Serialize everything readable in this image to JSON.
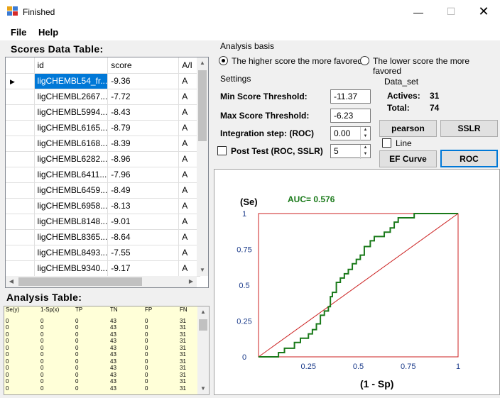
{
  "window": {
    "title": "Finished"
  },
  "menu": {
    "file": "File",
    "help": "Help"
  },
  "scores_table": {
    "title": "Scores Data Table:",
    "columns": [
      "id",
      "score",
      "A/I"
    ],
    "rows": [
      [
        "ligCHEMBL54_fr...",
        "-9.36",
        "A"
      ],
      [
        "ligCHEMBL2667...",
        "-7.72",
        "A"
      ],
      [
        "ligCHEMBL5994...",
        "-8.43",
        "A"
      ],
      [
        "ligCHEMBL6165...",
        "-8.79",
        "A"
      ],
      [
        "ligCHEMBL6168...",
        "-8.39",
        "A"
      ],
      [
        "ligCHEMBL6282...",
        "-8.96",
        "A"
      ],
      [
        "ligCHEMBL6411...",
        "-7.96",
        "A"
      ],
      [
        "ligCHEMBL6459...",
        "-8.49",
        "A"
      ],
      [
        "ligCHEMBL6958...",
        "-8.13",
        "A"
      ],
      [
        "ligCHEMBL8148...",
        "-9.01",
        "A"
      ],
      [
        "ligCHEMBL8365...",
        "-8.64",
        "A"
      ],
      [
        "ligCHEMBL8493...",
        "-7.55",
        "A"
      ],
      [
        "ligCHEMBL9340...",
        "-9.17",
        "A"
      ]
    ]
  },
  "analysis_table": {
    "title": "Analysis Table:",
    "columns": [
      "Se(y)",
      "1-Sp(x)",
      "TP",
      "TN",
      "FP",
      "FN"
    ],
    "rows": [
      [
        "0",
        "0",
        "0",
        "43",
        "0",
        "31"
      ],
      [
        "0",
        "0",
        "0",
        "43",
        "0",
        "31"
      ],
      [
        "0",
        "0",
        "0",
        "43",
        "0",
        "31"
      ],
      [
        "0",
        "0",
        "0",
        "43",
        "0",
        "31"
      ],
      [
        "0",
        "0",
        "0",
        "43",
        "0",
        "31"
      ],
      [
        "0",
        "0",
        "0",
        "43",
        "0",
        "31"
      ],
      [
        "0",
        "0",
        "0",
        "43",
        "0",
        "31"
      ],
      [
        "0",
        "0",
        "0",
        "43",
        "0",
        "31"
      ],
      [
        "0",
        "0",
        "0",
        "43",
        "0",
        "31"
      ],
      [
        "0",
        "0",
        "0",
        "43",
        "0",
        "31"
      ],
      [
        "0",
        "0",
        "0",
        "43",
        "0",
        "31"
      ]
    ]
  },
  "analysis_basis": {
    "label": "Analysis basis",
    "option_higher": "The higher score the more favored",
    "option_lower": "The lower  score the more favored",
    "selected": "higher"
  },
  "settings": {
    "label": "Settings",
    "min_label": "Min Score Threshold:",
    "min_value": "-11.37",
    "max_label": "Max Score Threshold:",
    "max_value": "-6.23",
    "step_label": "Integration step: (ROC)",
    "step_value": "0.00",
    "post_label": "Post Test (ROC, SSLR)",
    "post_value": "5",
    "post_checked": false
  },
  "dataset": {
    "label": "Data_set",
    "actives_label": "Actives:",
    "actives_value": "31",
    "total_label": "Total:",
    "total_value": "74"
  },
  "buttons": {
    "pearson": "pearson",
    "sslr": "SSLR",
    "line": "Line",
    "line_checked": false,
    "ef_curve": "EF Curve",
    "roc": "ROC"
  },
  "chart_data": {
    "type": "line",
    "annotation": "AUC= 0.576",
    "ylabel": "(Se)",
    "xlabel": "(1 - Sp)",
    "xlim": [
      0,
      1
    ],
    "ylim": [
      0,
      1
    ],
    "x_ticks": [
      "0.25",
      "0.5",
      "0.75",
      "1"
    ],
    "y_ticks": [
      "0",
      "0.25",
      "0.5",
      "0.75",
      "1"
    ],
    "colors": {
      "roc": "#1a7a1a",
      "diagonal": "#cc2222",
      "frame": "#cc2222",
      "annotation": "#1a7a1a"
    },
    "series": [
      {
        "x": [
          0.0,
          0.1,
          0.1,
          0.13,
          0.13,
          0.18,
          0.18,
          0.21,
          0.21,
          0.25,
          0.25,
          0.27,
          0.27,
          0.29,
          0.29,
          0.31,
          0.31,
          0.33,
          0.33,
          0.35,
          0.35,
          0.36,
          0.36,
          0.37,
          0.37,
          0.39,
          0.39,
          0.41,
          0.41,
          0.43,
          0.43,
          0.45,
          0.45,
          0.47,
          0.47,
          0.49,
          0.49,
          0.51,
          0.51,
          0.53,
          0.53,
          0.56,
          0.56,
          0.58,
          0.58,
          0.63,
          0.63,
          0.66,
          0.66,
          0.68,
          0.68,
          0.7,
          0.7,
          0.72,
          0.72,
          0.78,
          0.78,
          0.84,
          0.84,
          1.0
        ],
        "y": [
          0.0,
          0.0,
          0.03,
          0.03,
          0.06,
          0.06,
          0.1,
          0.1,
          0.13,
          0.13,
          0.16,
          0.16,
          0.19,
          0.19,
          0.23,
          0.23,
          0.29,
          0.29,
          0.32,
          0.32,
          0.35,
          0.35,
          0.42,
          0.42,
          0.45,
          0.45,
          0.52,
          0.52,
          0.55,
          0.55,
          0.58,
          0.58,
          0.61,
          0.61,
          0.65,
          0.65,
          0.68,
          0.68,
          0.71,
          0.71,
          0.77,
          0.77,
          0.81,
          0.81,
          0.84,
          0.84,
          0.87,
          0.87,
          0.9,
          0.9,
          0.94,
          0.94,
          0.97,
          0.97,
          0.97,
          0.97,
          1.0,
          1.0,
          1.0,
          1.0
        ]
      }
    ],
    "grid": false
  }
}
